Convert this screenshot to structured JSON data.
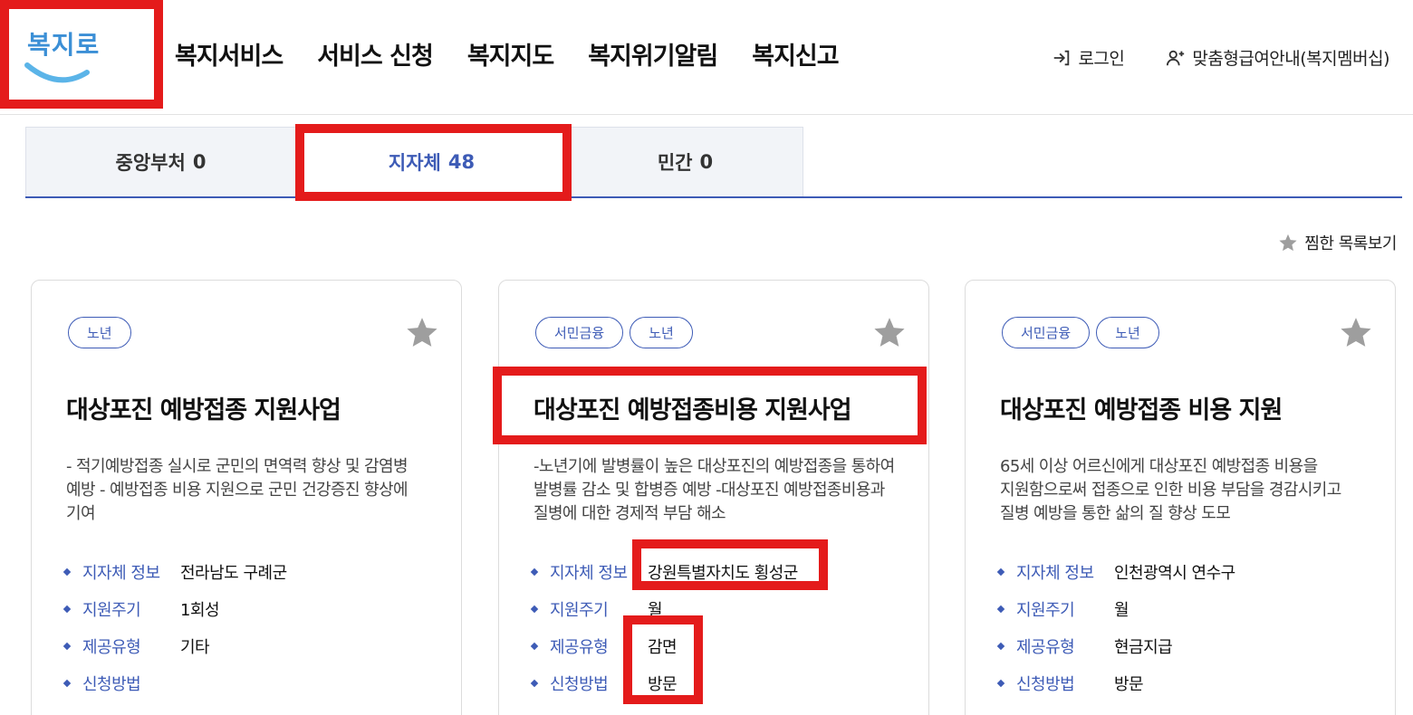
{
  "header": {
    "logo_text": "복지로",
    "nav": [
      "복지서비스",
      "서비스 신청",
      "복지지도",
      "복지위기알림",
      "복지신고"
    ],
    "login": "로그인",
    "membership": "맞춤형급여안내(복지멤버십)"
  },
  "tabs": [
    {
      "label": "중앙부처",
      "count": "0"
    },
    {
      "label": "지자체",
      "count": "48"
    },
    {
      "label": "민간",
      "count": "0"
    }
  ],
  "favorites_link": "찜한 목록보기",
  "labels": {
    "region": "지자체 정보",
    "cycle": "지원주기",
    "type": "제공유형",
    "method": "신청방법"
  },
  "cards": [
    {
      "badges": [
        "노년"
      ],
      "title": "대상포진 예방접종 지원사업",
      "desc": "- 적기예방접종 실시로 군민의 면역력 향상 및 감염병 예방 - 예방접종 비용 지원으로 군민 건강증진 향상에 기여",
      "region": "전라남도 구례군",
      "cycle": "1회성",
      "type": "기타",
      "method": ""
    },
    {
      "badges": [
        "서민금융",
        "노년"
      ],
      "title": "대상포진 예방접종비용 지원사업",
      "desc": "-노년기에 발병률이 높은 대상포진의 예방접종을 통하여 발병률 감소 및 합병증 예방 -대상포진 예방접종비용과 질병에 대한 경제적 부담 해소",
      "region": "강원특별자치도 횡성군",
      "cycle": "월",
      "type": "감면",
      "method": "방문"
    },
    {
      "badges": [
        "서민금융",
        "노년"
      ],
      "title": "대상포진 예방접종 비용 지원",
      "desc": "65세 이상 어르신에게 대상포진 예방접종 비용을 지원함으로써 접종으로 인한 비용 부담을 경감시키고 질병 예방을 통한 삶의 질 향상 도모",
      "region": "인천광역시 연수구",
      "cycle": "월",
      "type": "현금지급",
      "method": "방문"
    }
  ],
  "colors": {
    "accent": "#3d5bb6",
    "highlight": "#e41b1b",
    "star": "#9e9e9e"
  }
}
